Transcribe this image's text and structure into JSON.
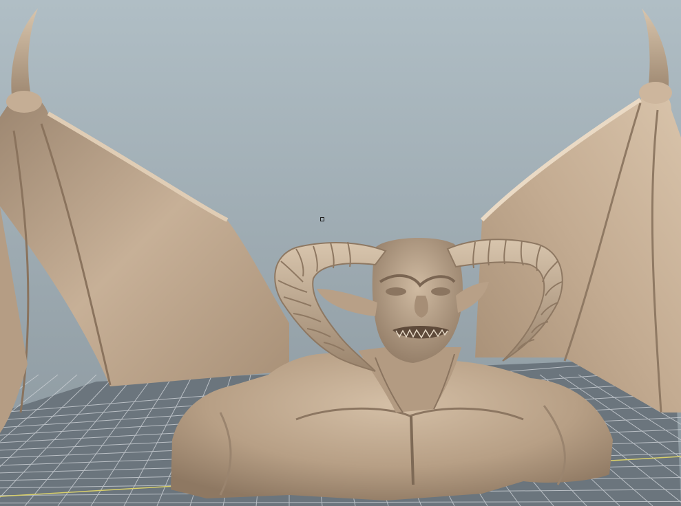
{
  "viewport": {
    "background_top": "#a9b8c0",
    "background_bottom": "#7f8b93",
    "grid_color": "#5f6a73",
    "grid_line_color": "#c9ced3",
    "grid_axis_color": "#d8d060",
    "model_color": "#c2ab91",
    "model_shadow": "#8a7560",
    "model_highlight": "#e2d1bc"
  },
  "scene": {
    "model": "horned-winged-demon-bust",
    "wings": [
      "left-wing",
      "right-wing"
    ],
    "horns": [
      "left-horn",
      "right-horn"
    ],
    "selection_marker": "pivot-square-icon"
  }
}
